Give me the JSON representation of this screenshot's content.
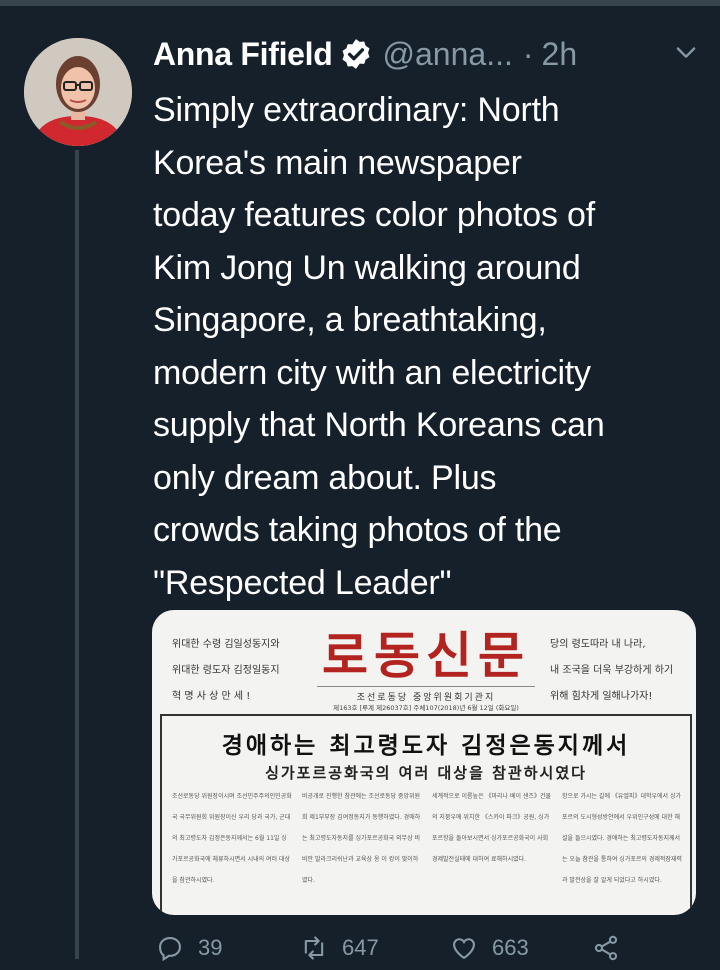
{
  "author": {
    "name": "Anna Fifield",
    "handle": "@anna...",
    "dot": "·",
    "time": "2h"
  },
  "tweet": {
    "lines": [
      "Simply extraordinary: North",
      "Korea's main newspaper",
      "today features color photos of",
      "Kim Jong Un walking around",
      "Singapore, a breathtaking,",
      "modern city with an electricity",
      "supply that North Koreans can",
      "only dream about. Plus",
      "crowds taking photos of the",
      "\"Respected Leader\""
    ]
  },
  "newspaper": {
    "left_lines": [
      "위대한 수령 김일성동지와",
      "위대한 령도자 김정일동지",
      "혁 명 사 상   만 세 !"
    ],
    "right_lines": [
      "당의 령도따라 내 나라,",
      "내 조국을 더욱 부강하게 하기",
      "위해 힘차게 일해나가자!"
    ],
    "title": "로동신문",
    "subtitle": "조선로동당 중앙위원회기관지",
    "issue": "제163호 [루계 제26037호] 주체107(2018)년 6월 12일 (화요일)",
    "headline": "경애하는 최고령도자 김정은동지께서",
    "subheadline": "싱가포르공화국의 여러 대상을 참관하시였다",
    "col1": "조선로동당 위원장이시며 조선민주주의인민공화국 국무위원회 위원장이신 우리 당과 국가, 군대의 최고령도자 김정은동지께서는 6월 11일 싱가포르공화국에 체류하시면서 시내의 여러 대상을 참관하시였다.",
    "col2": "비공개로 진행한 참관에는 조선로동당 중앙위원회 제1부부장 김여정동지가 동행하였다. 경애하는 최고령도자동지를 싱가포르공화국 외무상 비비안 발라크리쉬난과 교육상 옹 이 캉이 맞이하였다.",
    "col3": "세계적으로 이름높은 《마리나 베이 샌즈》건물의 지붕우에 위치한 《스카이 파크》공원, 싱가포르항을 돌아보시면서 싱가포르공화국이 사회경제발전실태에 대하여 료해하시였다.",
    "col4": "항으로 가시는 길에 《유엘피》대학우에서 싱가포르의 도시형성방안에서 우위인구성에 대한 해설을 들으시였다. 경애하는 최고령도자동지께서는 오늘 참관을 통하여 싱가포르의 경제적잠재력과 발전상을 잘 알게 되었다고 하시였다."
  },
  "actions": {
    "reply_count": "39",
    "retweet_count": "647",
    "like_count": "663"
  },
  "colors": {
    "background": "#15202b",
    "muted": "#8899a6",
    "verified": "#ffffff",
    "masthead": "#b3231f"
  }
}
